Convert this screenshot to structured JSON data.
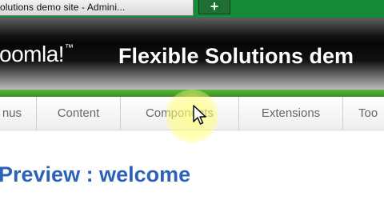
{
  "browser": {
    "tab_title": "olutions demo site - Admini...",
    "new_tab_icon": "plus-icon",
    "new_tab_symbol": "+"
  },
  "header": {
    "logo_text": "oomla!",
    "logo_tm": "™",
    "site_title": "Flexible Solutions dem"
  },
  "menu": {
    "items": [
      {
        "label": "nus"
      },
      {
        "label": "Content"
      },
      {
        "label": "Components"
      },
      {
        "label": "Extensions"
      },
      {
        "label": "Too"
      }
    ]
  },
  "main": {
    "preview_title": "Preview : welcome"
  },
  "cursor": {
    "icon": "mouse-pointer-icon",
    "highlight_color": "#ffff78"
  },
  "colors": {
    "browser_bar": "#178a3a",
    "green_accent": "#4fa82f",
    "title_blue": "#2d62b8",
    "menu_text": "#666666"
  }
}
